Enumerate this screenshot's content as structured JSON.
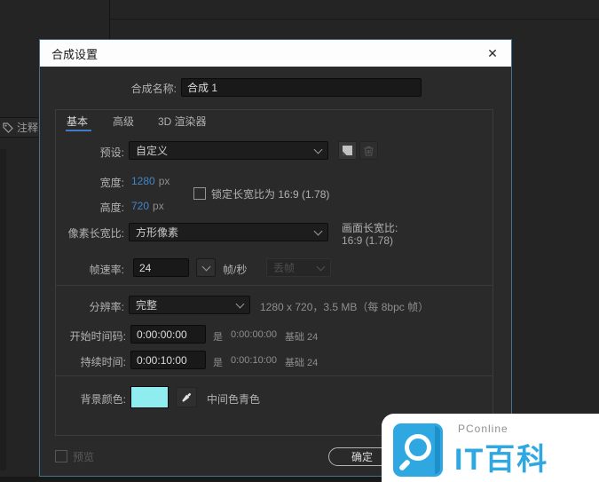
{
  "app_background": {
    "notes_label": "注释"
  },
  "dialog": {
    "title": "合成设置",
    "close_glyph": "✕",
    "name_row": {
      "label": "合成名称:",
      "value": "合成 1"
    },
    "tabs": [
      {
        "label": "基本"
      },
      {
        "label": "高级"
      },
      {
        "label": "3D 渲染器"
      }
    ],
    "preset_row": {
      "label": "预设:",
      "value": "自定义"
    },
    "width_row": {
      "label": "宽度:",
      "value": "1280",
      "unit": "px"
    },
    "height_row": {
      "label": "高度:",
      "value": "720",
      "unit": "px"
    },
    "lock_aspect_row": {
      "label": "锁定长宽比为 16:9 (1.78)",
      "checked": false
    },
    "pixel_aspect_row": {
      "label": "像素长宽比:",
      "value": "方形像素"
    },
    "frame_aspect": {
      "label": "画面长宽比:",
      "value": "16:9 (1.78)"
    },
    "frame_rate_row": {
      "label": "帧速率:",
      "value": "24",
      "unit": "帧/秒",
      "dropframe_value": "丢帧"
    },
    "resolution_row": {
      "label": "分辨率:",
      "value": "完整",
      "info": "1280 x 720，3.5 MB（每 8bpc 帧）"
    },
    "start_row": {
      "label": "开始时间码:",
      "value": "0:00:00:00",
      "eq": "是",
      "eq_value": "0:00:00:00",
      "base": "基础 24"
    },
    "duration_row": {
      "label": "持续时间:",
      "value": "0:00:10:00",
      "eq": "是",
      "eq_value": "0:00:10:00",
      "base": "基础 24"
    },
    "bgcolor_row": {
      "label": "背景颜色:",
      "swatch_color": "#8FEDF0",
      "color_name": "中间色青色"
    },
    "footer": {
      "preview_label": "预览",
      "ok_label": "确定"
    }
  },
  "watermark": {
    "brand": "PConline",
    "title": "IT百科",
    "accent": "#2FA8E1"
  },
  "colors": {
    "accent_blue": "#4285C8",
    "tab_underline": "#3C7DC4",
    "dialog_border": "#44728F",
    "titlebar_bg": "#FFFFFF",
    "dialog_bg": "#2A2A2A",
    "swatch": "#8FEDF0",
    "watermark_accent": "#2FA8E1"
  }
}
